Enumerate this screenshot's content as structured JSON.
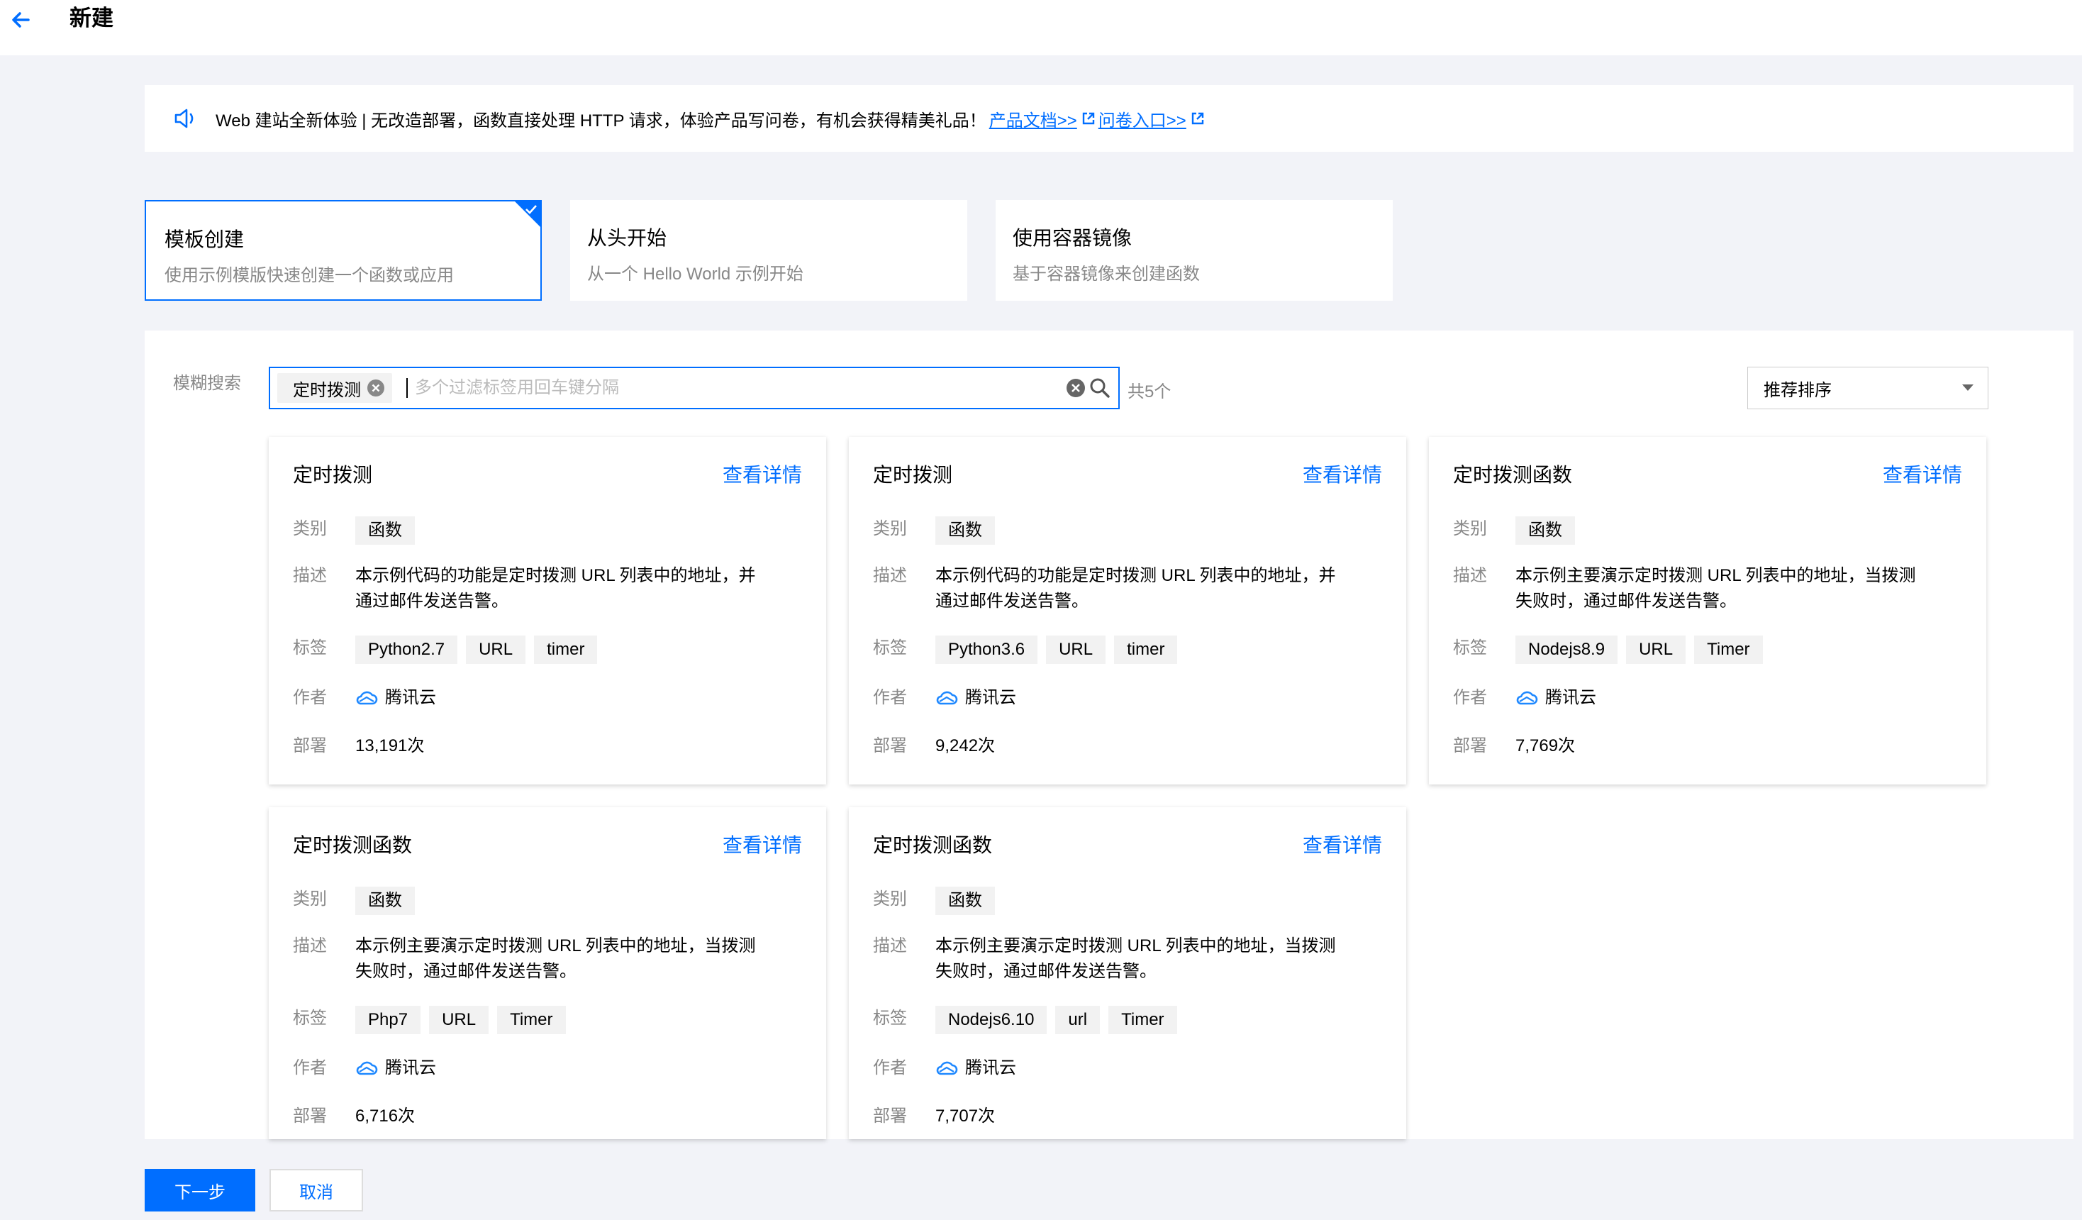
{
  "header": {
    "title": "新建"
  },
  "notice": {
    "text": "Web 建站全新体验 | 无改造部署，函数直接处理 HTTP 请求，体验产品写问卷，有机会获得精美礼品！",
    "link1": "产品文档>>",
    "link2": "问卷入口>>"
  },
  "modes": [
    {
      "title": "模板创建",
      "desc": "使用示例模版快速创建一个函数或应用",
      "selected": true
    },
    {
      "title": "从头开始",
      "desc": "从一个 Hello World 示例开始"
    },
    {
      "title": "使用容器镜像",
      "desc": "基于容器镜像来创建函数"
    }
  ],
  "search": {
    "label": "模糊搜索",
    "tag": "定时拨测",
    "placeholder": "多个过滤标签用回车键分隔",
    "count": "共5个"
  },
  "sort": {
    "selected": "推荐排序"
  },
  "field_labels": {
    "category": "类别",
    "desc": "描述",
    "tags": "标签",
    "author": "作者",
    "deploy": "部署"
  },
  "detail_label": "查看详情",
  "templates": [
    {
      "name": "定时拨测",
      "category": "函数",
      "desc_line1": "本示例代码的功能是定时拨测 URL 列表中的地址，并",
      "desc_line2": "通过邮件发送告警。",
      "tags": [
        "Python2.7",
        "URL",
        "timer"
      ],
      "author": "腾讯云",
      "deploys": "13,191次"
    },
    {
      "name": "定时拨测",
      "category": "函数",
      "desc_line1": "本示例代码的功能是定时拨测 URL 列表中的地址，并",
      "desc_line2": "通过邮件发送告警。",
      "tags": [
        "Python3.6",
        "URL",
        "timer"
      ],
      "author": "腾讯云",
      "deploys": "9,242次"
    },
    {
      "name": "定时拨测函数",
      "category": "函数",
      "desc_line1": "本示例主要演示定时拨测 URL 列表中的地址，当拨测",
      "desc_line2": "失败时，通过邮件发送告警。",
      "tags": [
        "Nodejs8.9",
        "URL",
        "Timer"
      ],
      "author": "腾讯云",
      "deploys": "7,769次"
    },
    {
      "name": "定时拨测函数",
      "category": "函数",
      "desc_line1": "本示例主要演示定时拨测 URL 列表中的地址，当拨测",
      "desc_line2": "失败时，通过邮件发送告警。",
      "tags": [
        "Php7",
        "URL",
        "Timer"
      ],
      "author": "腾讯云",
      "deploys": "6,716次"
    },
    {
      "name": "定时拨测函数",
      "category": "函数",
      "desc_line1": "本示例主要演示定时拨测 URL 列表中的地址，当拨测",
      "desc_line2": "失败时，通过邮件发送告警。",
      "tags": [
        "Nodejs6.10",
        "url",
        "Timer"
      ],
      "author": "腾讯云",
      "deploys": "7,707次"
    }
  ],
  "footer": {
    "next": "下一步",
    "cancel": "取消"
  },
  "colors": {
    "accent": "#006eff",
    "background": "#f2f3f8"
  }
}
